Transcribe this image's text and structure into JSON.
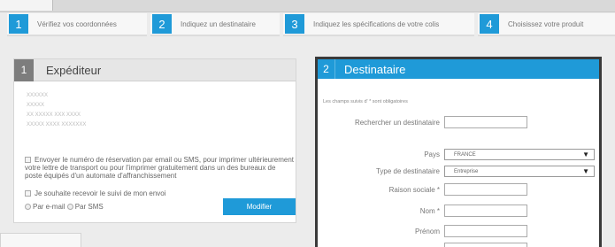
{
  "steps": [
    {
      "num": "1",
      "label": "Vérifiez vos coordonnées"
    },
    {
      "num": "2",
      "label": "Indiquez un destinataire"
    },
    {
      "num": "3",
      "label": "Indiquez les spécifications de votre colis"
    },
    {
      "num": "4",
      "label": "Choisissez votre produit"
    }
  ],
  "expediteur": {
    "num": "1",
    "title": "Expéditeur",
    "address_lines": [
      "XXXXXX",
      "XXXXX",
      "XX XXXXX XXX XXXX",
      "XXXXX XXXX XXXXXXX"
    ],
    "option_sms": "Envoyer le numéro de réservation par email ou SMS, pour imprimer ultérieurement votre lettre de transport ou pour l'imprimer gratuitement dans un des bureaux de poste équipés d'un automate d'affranchissement",
    "option_suivi": "Je souhaite recevoir le suivi de mon envoi",
    "radio_email": "Par e-mail",
    "radio_sms": "Par SMS",
    "modify_button": "Modifier"
  },
  "destinataire": {
    "num": "2",
    "title": "Destinataire",
    "required_note": "Les champs suivis d' * sont obligatoires",
    "search_label": "Rechercher un destinataire",
    "pays_label": "Pays",
    "pays_value": "FRANCE",
    "type_label": "Type de destinataire",
    "type_value": "Entreprise",
    "raison_label": "Raison sociale *",
    "nom_label": "Nom *",
    "prenom_label": "Prénom"
  },
  "colors": {
    "accent": "#1f9ad8",
    "dark_panel": "#3a3a3a",
    "grey_num": "#7d7d7d"
  }
}
